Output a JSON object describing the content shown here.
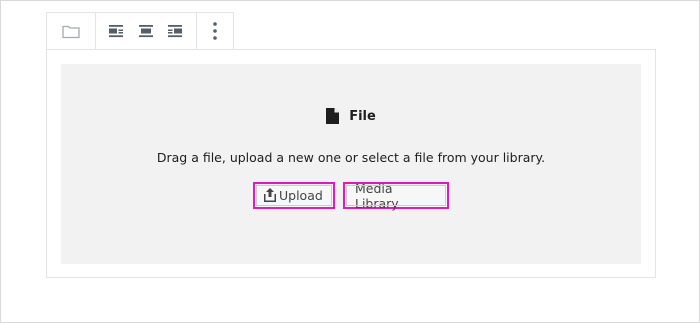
{
  "toolbar": {
    "icons": [
      "folder-icon",
      "align-left-icon",
      "align-center-icon",
      "align-right-icon",
      "more-options-icon"
    ]
  },
  "placeholder": {
    "label": "File",
    "instructions": "Drag a file, upload a new one or select a file from your library.",
    "upload_label": "Upload",
    "media_library_label": "Media Library"
  },
  "colors": {
    "highlight": "#e01bbb",
    "placeholder_bg": "#f2f2f2",
    "icon_gray": "#555d66"
  }
}
